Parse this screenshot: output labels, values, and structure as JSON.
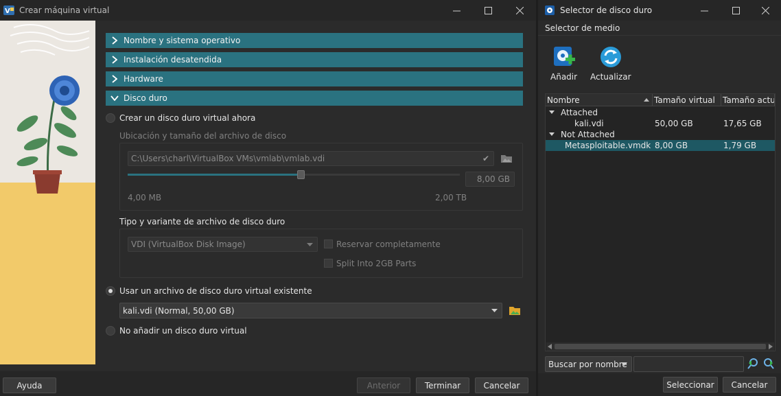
{
  "main_window": {
    "title": "Crear máquina virtual",
    "sections": {
      "name_os": "Nombre y sistema operativo",
      "unattended": "Instalación desatendida",
      "hardware": "Hardware",
      "hard_disk": "Disco duro"
    },
    "create_new": {
      "label": "Crear un disco duro virtual ahora",
      "location_label": "Ubicación y tamaño del archivo de disco",
      "path": "C:\\Users\\charl\\VirtualBox VMs\\vmlab\\vmlab.vdi",
      "size_value": "8,00 GB",
      "size_fraction": 0.52,
      "min_label": "4,00 MB",
      "max_label": "2,00 TB",
      "type_label": "Tipo y variante de archivo de disco duro",
      "type_value": "VDI (VirtualBox Disk Image)",
      "preallocate_label": "Reservar completamente",
      "split_label": "Split Into 2GB Parts"
    },
    "use_existing": {
      "label": "Usar un archivo de disco duro virtual existente",
      "value": "kali.vdi (Normal, 50,00 GB)"
    },
    "no_disk": {
      "label": "No añadir un disco duro virtual"
    },
    "footer": {
      "help": "Ayuda",
      "back": "Anterior",
      "finish": "Terminar",
      "cancel": "Cancelar"
    }
  },
  "selector_window": {
    "title": "Selector de disco duro",
    "menu": "Selector de medio",
    "toolbar": {
      "add": "Añadir",
      "refresh": "Actualizar"
    },
    "columns": [
      "Nombre",
      "Tamaño virtual",
      "Tamaño actual"
    ],
    "groups": [
      {
        "label": "Attached",
        "items": [
          {
            "name": "kali.vdi",
            "virtual_size": "50,00 GB",
            "actual_size": "17,65 GB"
          }
        ]
      },
      {
        "label": "Not Attached",
        "items": [
          {
            "name": "Metasploitable.vmdk",
            "virtual_size": "8,00 GB",
            "actual_size": "1,79 GB"
          }
        ]
      }
    ],
    "search_mode": "Buscar por nombre",
    "search_value": "",
    "buttons": {
      "select": "Seleccionar",
      "cancel": "Cancelar"
    }
  },
  "colors": {
    "accent": "#2a7280",
    "selection": "#1e5863"
  }
}
